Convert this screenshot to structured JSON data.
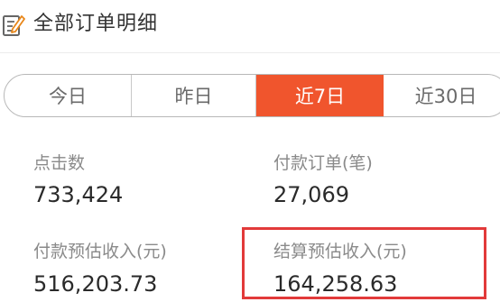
{
  "header": {
    "title": "全部订单明细",
    "icon": "edit-note-icon"
  },
  "tabs": [
    {
      "label": "今日",
      "active": false
    },
    {
      "label": "昨日",
      "active": false
    },
    {
      "label": "近7日",
      "active": true
    },
    {
      "label": "近30日",
      "active": false
    }
  ],
  "stats": {
    "clicks": {
      "label": "点击数",
      "value": "733,424"
    },
    "paid_orders": {
      "label": "付款订单(笔)",
      "value": "27,069"
    },
    "paid_estimated_income": {
      "label": "付款预估收入(元)",
      "value": "516,203.73"
    },
    "settled_estimated_income": {
      "label": "结算预估收入(元)",
      "value": "164,258.63"
    }
  },
  "colors": {
    "accent": "#f0552d",
    "highlight": "#e23a3a"
  }
}
